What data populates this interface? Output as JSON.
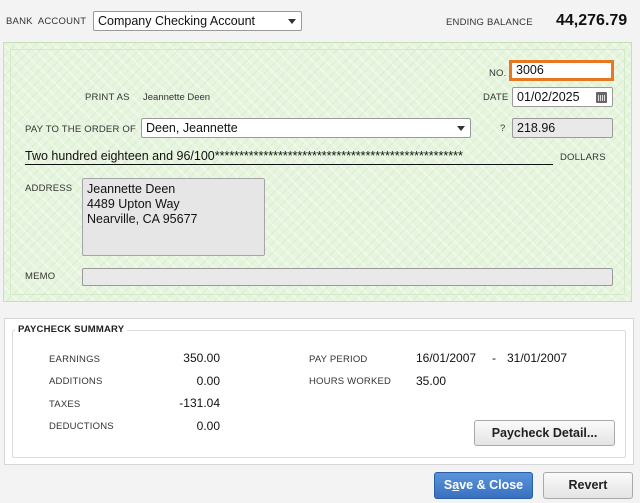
{
  "header": {
    "bank_account_label_1": "BANK",
    "bank_account_label_2": "ACCOUNT",
    "bank_account_value": "Company Checking Account",
    "ending_balance_label": "ENDING BALANCE",
    "ending_balance_value": "44,276.79"
  },
  "check": {
    "no_label": "NO.",
    "no_value": "3006",
    "print_as_label": "PRINT AS",
    "print_as_value": "Jeannette Deen",
    "date_label": "DATE",
    "date_value": "01/02/2025",
    "pay_to_label": "PAY TO THE ORDER OF",
    "payee_value": "Deen, Jeannette",
    "amount_symbol": "?",
    "amount_value": "218.96",
    "amount_words": "Two hundred eighteen and 96/100***************************************************",
    "dollars_label": "DOLLARS",
    "address_label": "ADDRESS",
    "address_lines": [
      "Jeannette Deen",
      "4489 Upton Way",
      "Nearville, CA 95677"
    ],
    "memo_label": "MEMO",
    "memo_value": ""
  },
  "summary": {
    "title": "PAYCHECK SUMMARY",
    "rows": [
      {
        "label": "EARNINGS",
        "value": "350.00"
      },
      {
        "label": "ADDITIONS",
        "value": "0.00"
      },
      {
        "label": "TAXES",
        "value": "-131.04"
      },
      {
        "label": "DEDUCTIONS",
        "value": "0.00"
      }
    ],
    "pay_period_label": "PAY PERIOD",
    "pay_period_start": "16/01/2007",
    "pay_period_sep": "-",
    "pay_period_end": "31/01/2007",
    "hours_worked_label": "HOURS WORKED",
    "hours_worked_value": "35.00",
    "detail_button": "Paycheck Detail..."
  },
  "footer": {
    "save_close_prefix": "S",
    "save_close_underline": "a",
    "save_close_rest": "ve & Close",
    "revert_label": "Revert"
  },
  "colors": {
    "check_bg": "#e7f5df",
    "number_highlight": "#e87722",
    "primary_button": "#3871c1"
  }
}
